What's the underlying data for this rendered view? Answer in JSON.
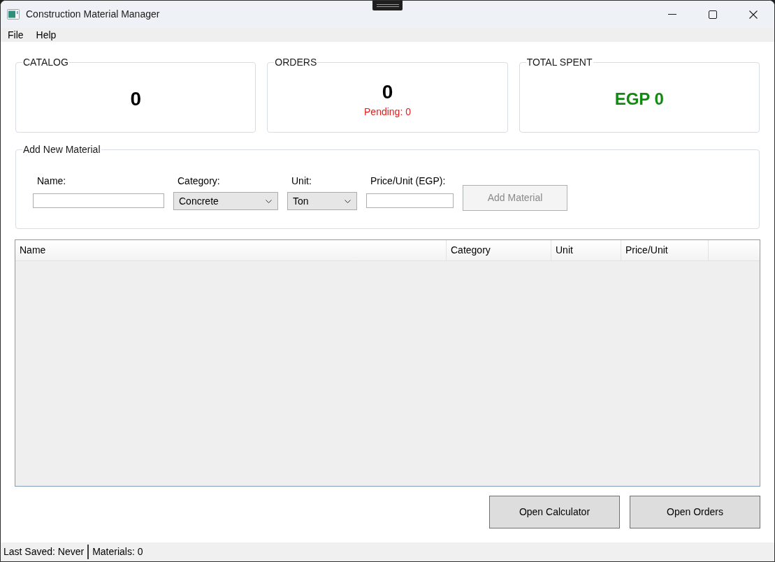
{
  "window": {
    "title": "Construction Material Manager"
  },
  "menu": [
    "File",
    "Help"
  ],
  "summary_cards": [
    {
      "title": "CATALOG",
      "value": "0",
      "kind": "count"
    },
    {
      "title": "ORDERS",
      "value": "0",
      "note": "Pending: 0",
      "kind": "count"
    },
    {
      "title": "TOTAL SPENT",
      "value": "EGP 0",
      "kind": "money"
    }
  ],
  "add_material": {
    "title": "Add New Material",
    "fields": [
      {
        "kind": "text",
        "label": "Name:"
      },
      {
        "kind": "select",
        "label": "Category:",
        "value": "Concrete"
      },
      {
        "kind": "select",
        "label": "Unit:",
        "value": "Ton"
      },
      {
        "kind": "text",
        "label": "Price/Unit (EGP):"
      }
    ],
    "button": {
      "label": "Add Material",
      "disabled": true
    }
  },
  "table": {
    "columns": [
      "Name",
      "Category",
      "Unit",
      "Price/Unit"
    ]
  },
  "actions": [
    "Open Calculator",
    "Open Orders"
  ],
  "status_bar": [
    "Last Saved: Never",
    "Materials: 0"
  ]
}
